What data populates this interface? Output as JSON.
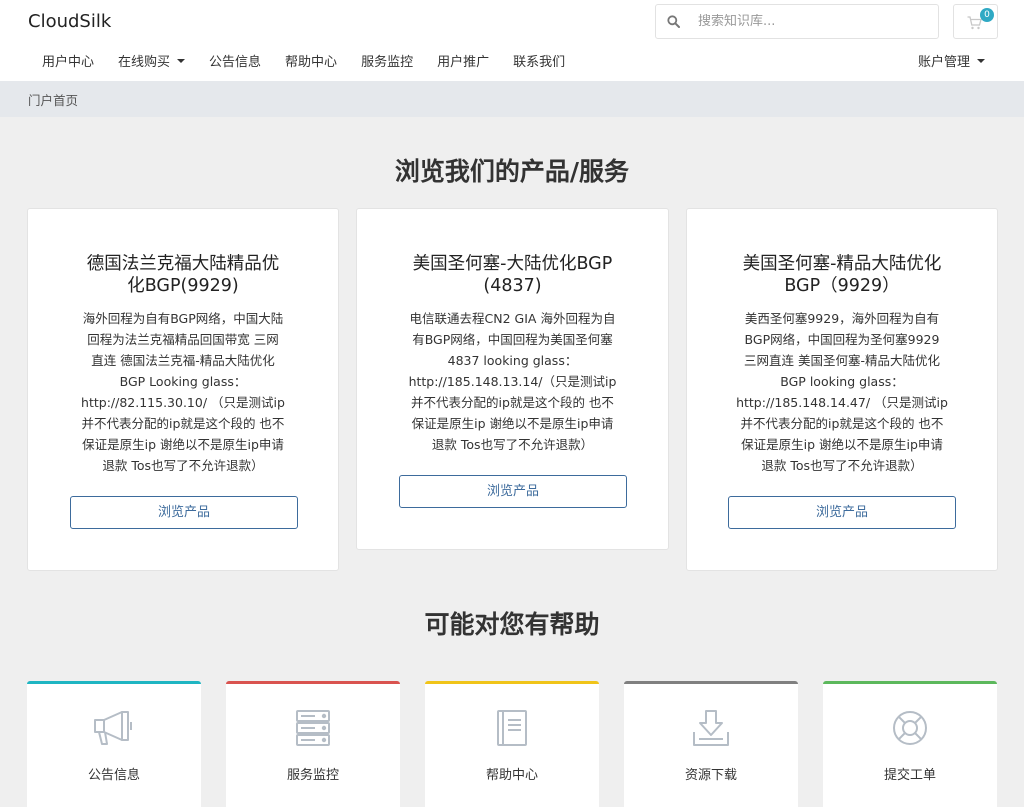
{
  "header": {
    "logo": "CloudSilk",
    "search_placeholder": "搜索知识库...",
    "cart_count": "0",
    "search_icon": "search-icon",
    "cart_icon": "cart-icon"
  },
  "nav": {
    "items": [
      "用户中心",
      "在线购买",
      "公告信息",
      "帮助中心",
      "服务监控",
      "用户推广",
      "联系我们"
    ],
    "account": "账户管理"
  },
  "breadcrumb": "门户首页",
  "products": {
    "heading": "浏览我们的产品/服务",
    "button_label": "浏览产品",
    "cards": [
      {
        "title_lines": [
          "德国法兰克福大陆精品优",
          "化BGP(9929)"
        ],
        "desc_lines": [
          "海外回程为自有BGP网络，中国大陆",
          "回程为法兰克福精品回国带宽 三网",
          "直连 德国法兰克福-精品大陆优化",
          "BGP Looking glass：",
          "http://82.115.30.10/ （只是测试ip",
          "并不代表分配的ip就是这个段的 也不",
          "保证是原生ip 谢绝以不是原生ip申请",
          "退款 Tos也写了不允许退款）"
        ]
      },
      {
        "title_lines": [
          "美国圣何塞-大陆优化BGP",
          "(4837)"
        ],
        "desc_lines": [
          "电信联通去程CN2 GIA 海外回程为自",
          "有BGP网络，中国回程为美国圣何塞",
          "4837 looking glass：",
          "http://185.148.13.14/（只是测试ip",
          "并不代表分配的ip就是这个段的 也不",
          "保证是原生ip 谢绝以不是原生ip申请",
          "退款 Tos也写了不允许退款）"
        ]
      },
      {
        "title_lines": [
          "美国圣何塞-精品大陆优化",
          "BGP（9929）"
        ],
        "desc_lines": [
          "美西圣何塞9929，海外回程为自有",
          "BGP网络，中国回程为圣何塞9929",
          "三网直连 美国圣何塞-精品大陆优化",
          "BGP looking glass：",
          "http://185.148.14.47/ （只是测试ip",
          "并不代表分配的ip就是这个段的 也不",
          "保证是原生ip 谢绝以不是原生ip申请",
          "退款 Tos也写了不允许退款）"
        ]
      }
    ]
  },
  "help": {
    "heading": "可能对您有帮助",
    "cards": [
      {
        "label": "公告信息",
        "icon": "megaphone-icon",
        "color": "#1fb5c2"
      },
      {
        "label": "服务监控",
        "icon": "server-icon",
        "color": "#d9534f"
      },
      {
        "label": "帮助中心",
        "icon": "book-icon",
        "color": "#f0c419"
      },
      {
        "label": "资源下载",
        "icon": "download-icon",
        "color": "#808080"
      },
      {
        "label": "提交工单",
        "icon": "lifebuoy-icon",
        "color": "#5cb85c"
      }
    ]
  }
}
